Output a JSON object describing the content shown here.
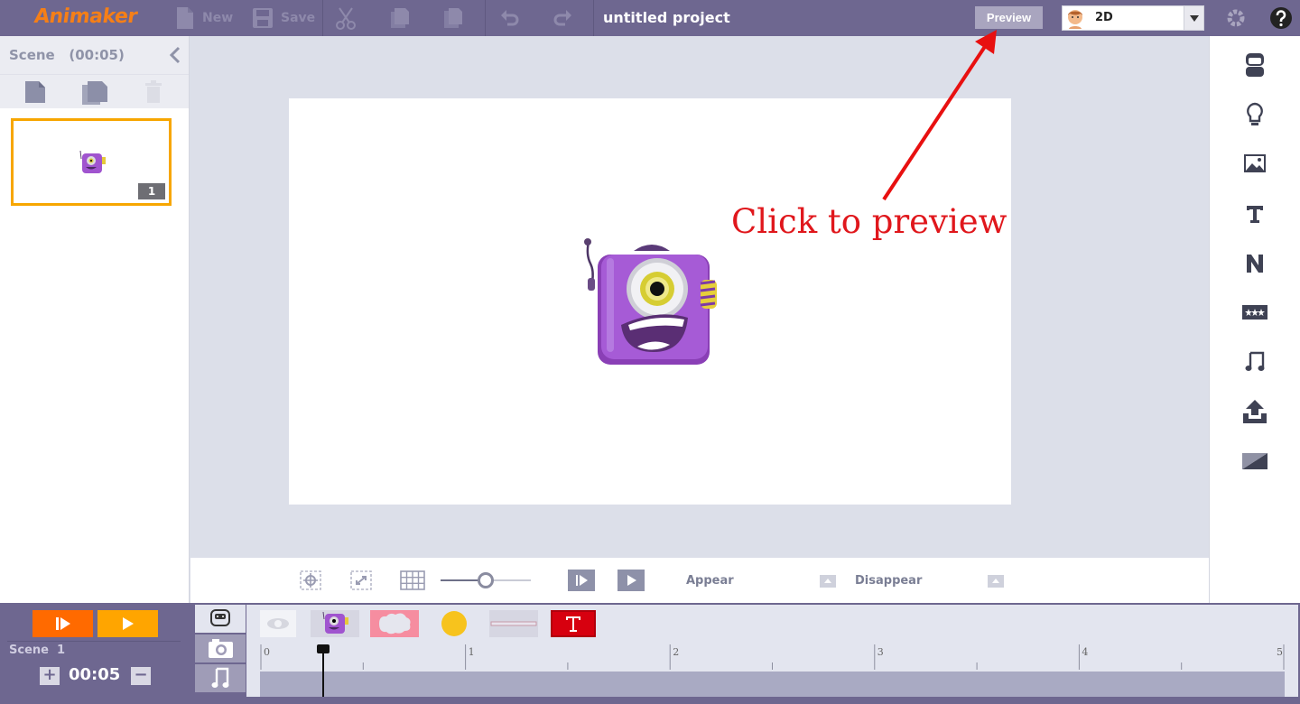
{
  "app": {
    "logo": "Animaker",
    "project_title": "untitled project"
  },
  "toolbar": {
    "new_label": "New",
    "save_label": "Save",
    "preview_label": "Preview",
    "mode_value": "2D"
  },
  "scene_panel": {
    "title": "Scene   (00:05)",
    "scenes": [
      {
        "number": "1"
      }
    ]
  },
  "annotation": {
    "text": "Click to preview",
    "color": "#e0171c"
  },
  "stage_controls": {
    "appear_label": "Appear",
    "disappear_label": "Disappear",
    "zoom_level": 0.5
  },
  "right_bar": {
    "icons": [
      "character-icon",
      "idea-icon",
      "image-icon",
      "text-icon",
      "number-icon",
      "rating-icon",
      "music-icon",
      "upload-icon",
      "background-icon"
    ]
  },
  "timeline": {
    "scene_label": "Scene  1",
    "duration": "00:05",
    "ruler": [
      "0",
      "1",
      "2",
      "3",
      "4",
      "5"
    ],
    "playhead_seconds": 0.3,
    "objects": [
      "eye-icon",
      "character",
      "cloud-shape",
      "circle-shape",
      "line-shape",
      "text-object"
    ]
  },
  "colors": {
    "topbar": "#6e6790",
    "accent_orange": "#ff6a00",
    "accent_amber": "#ffa500",
    "selected_scene_border": "#f7a600"
  }
}
